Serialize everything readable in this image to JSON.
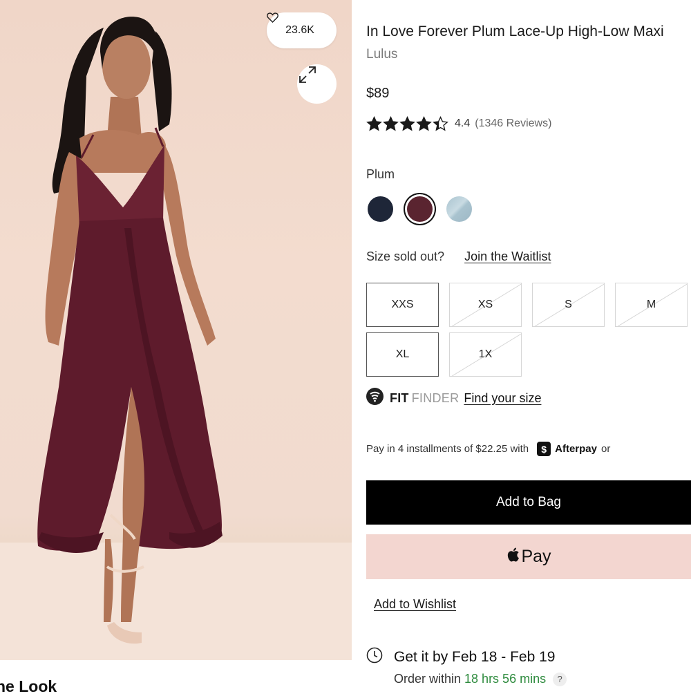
{
  "gallery": {
    "likes_count": "23.6K",
    "heart_icon": "heart-outline-icon",
    "expand_icon": "expand-arrows-icon",
    "section_heading": "he Look"
  },
  "product": {
    "title": "In Love Forever Plum Lace-Up High-Low Maxi",
    "brand": "Lulus",
    "price": "$89",
    "rating": {
      "value": "4.4",
      "reviews": "(1346 Reviews)",
      "stars_filled": 4.4,
      "stars_total": 5
    },
    "color": {
      "label": "Plum",
      "swatches": [
        {
          "name": "navy",
          "color": "#1e2638",
          "selected": false
        },
        {
          "name": "plum",
          "color": "#5a2430",
          "selected": true
        },
        {
          "name": "light-blue",
          "color": "#a9c3cf",
          "selected": false
        }
      ]
    },
    "waitlist": {
      "prompt": "Size sold out?",
      "link": "Join the Waitlist"
    },
    "sizes": [
      {
        "label": "XXS",
        "available": true
      },
      {
        "label": "XS",
        "available": false
      },
      {
        "label": "S",
        "available": false
      },
      {
        "label": "M",
        "available": false
      },
      {
        "label": "XL",
        "available": true
      },
      {
        "label": "1X",
        "available": false
      }
    ],
    "fit_finder": {
      "bold": "FIT",
      "light": "FINDER",
      "link": "Find your size"
    },
    "payment": {
      "installments_text": "Pay in 4 installments of $22.25 with",
      "badge": "$",
      "provider": "Afterpay",
      "suffix": "or"
    },
    "actions": {
      "add_to_bag": "Add to Bag",
      "apple_pay": "Pay",
      "add_to_wishlist": "Add to Wishlist"
    },
    "delivery": {
      "headline": "Get it by Feb 18 - Feb 19",
      "order_prefix": "Order within",
      "order_time": "18 hrs 56 mins",
      "help": "?"
    }
  },
  "colors": {
    "accent_black": "#000000",
    "apple_pay_bg": "#f3d6d0",
    "order_time_green": "#2e8b3e",
    "star": "#1a1a1a"
  }
}
